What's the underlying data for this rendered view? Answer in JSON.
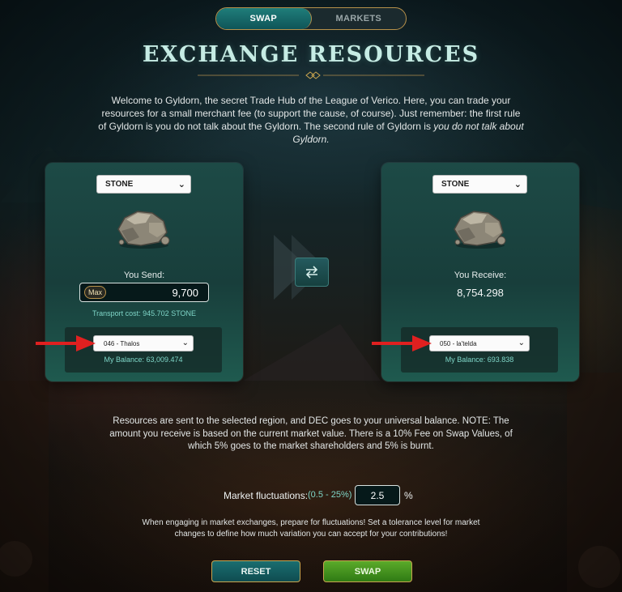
{
  "tabs": [
    {
      "label": "SWAP",
      "active": true
    },
    {
      "label": "MARKETS",
      "active": false
    }
  ],
  "header": {
    "title": "EXCHANGE RESOURCES",
    "intro_main": "Welcome to Gyldorn, the secret Trade Hub of the League of Verico. Here, you can trade your resources for a small merchant fee (to support the cause, of course). Just remember: the first rule of Gyldorn is you do not talk about the Gyldorn. The second rule of Gyldorn is ",
    "intro_italic": "you do not talk about Gyldorn."
  },
  "send_panel": {
    "resource": "STONE",
    "resource_icon": "stone-icon",
    "label": "You Send:",
    "max_label": "Max",
    "amount": "9,700",
    "transport_cost": "Transport cost: 945.702 STONE",
    "region": "046 - Thalos",
    "balance": "My Balance: 63,009.474"
  },
  "receive_panel": {
    "resource": "STONE",
    "resource_icon": "stone-icon",
    "label": "You Receive:",
    "amount": "8,754.298",
    "region": "050 - la'telda",
    "balance": "My Balance: 693.838"
  },
  "swap_direction_icon": "swap-arrows-icon",
  "note": "Resources are sent to the selected region, and DEC goes to your universal balance. NOTE: The amount you receive is based on the current market value. There is a 10% Fee on Swap Values, of which 5% goes to the market shareholders and 5% is burnt.",
  "fluctuation": {
    "label": "Market fluctuations:",
    "range": "(0.5 - 25%)",
    "value": "2.5",
    "unit": "%"
  },
  "warning": "When engaging in market exchanges, prepare for fluctuations! Set a tolerance level for market changes to define how much variation you can accept for your contributions!",
  "actions": {
    "reset": "RESET",
    "swap": "SWAP"
  },
  "colors": {
    "accent_teal": "#7fd6c8",
    "gold_border": "#b7914a",
    "swap_green": "#4c9a22",
    "annotation_red": "#e02020"
  }
}
